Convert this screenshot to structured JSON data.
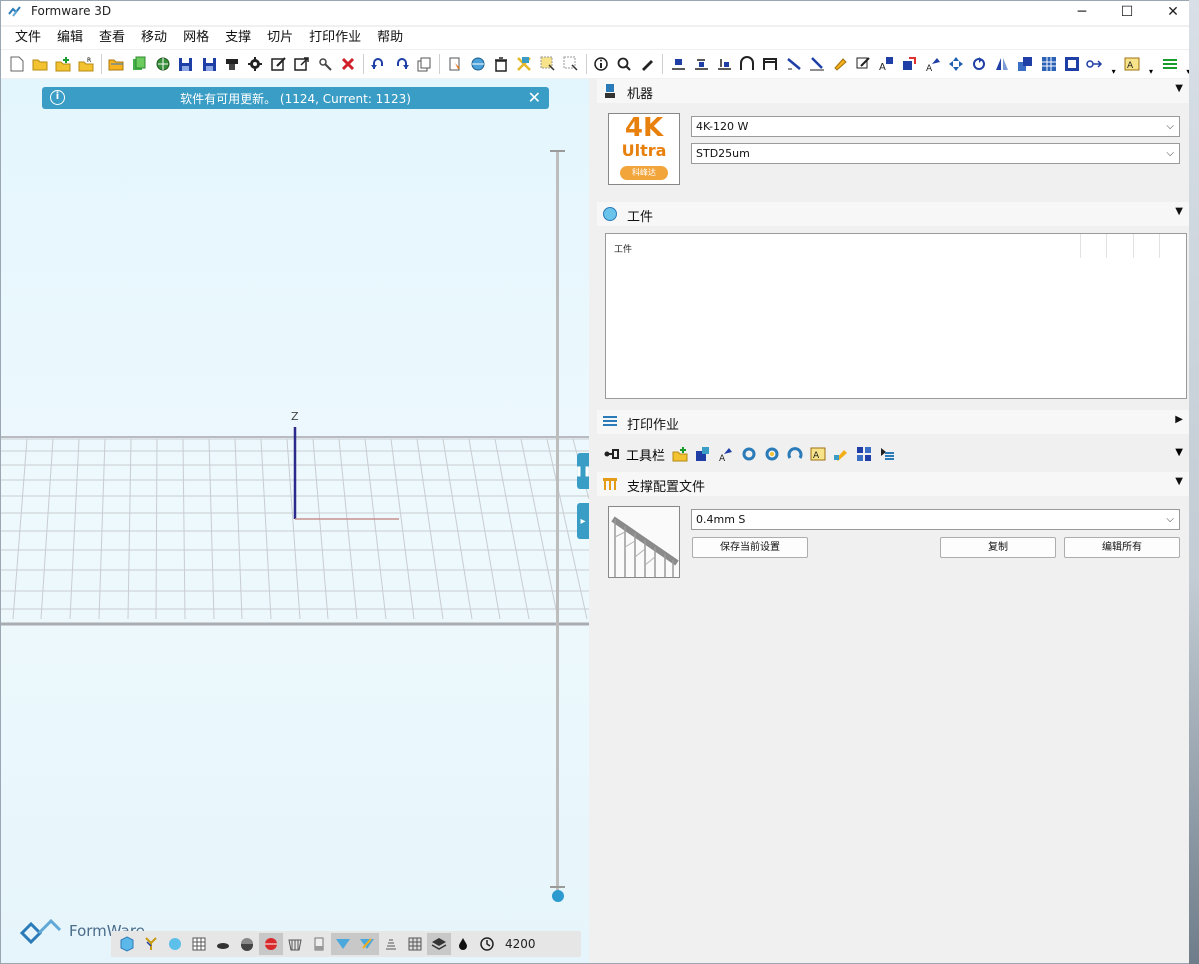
{
  "window": {
    "title": "Formware 3D",
    "controls": {
      "minimize": "─",
      "maximize": "☐",
      "close": "✕"
    }
  },
  "menu": [
    "文件",
    "编辑",
    "查看",
    "移动",
    "网格",
    "支撑",
    "切片",
    "打印作业",
    "帮助"
  ],
  "toolbar_icons": [
    "new-file-icon",
    "open-folder-icon",
    "add-part-icon",
    "add-recent-icon",
    "open-project-icon",
    "copy-green-icon",
    "import-globe-icon",
    "save-icon",
    "save-as-icon",
    "print-icon",
    "settings-gear-icon",
    "edit-icon",
    "export-icon",
    "repair-icon",
    "delete-icon",
    "undo-icon",
    "redo-icon",
    "duplicate-icon",
    "select-icon",
    "view-globe-icon",
    "trash-icon",
    "scale-icon",
    "select-region-icon",
    "deselect-icon",
    "info-icon",
    "search-icon",
    "paint-icon",
    "align-bottom-icon",
    "align-h-icon",
    "align-down-icon",
    "support-arch-icon",
    "support-frame-icon",
    "measure-icon",
    "measure-angle-icon",
    "highlight-icon",
    "pencil-icon",
    "text-icon",
    "orient-icon",
    "label-icon",
    "arrange-icon",
    "rotate-icon",
    "mirror-icon",
    "layout-icon",
    "grid-icon",
    "hollow-icon",
    "link-icon",
    "text-tag-icon",
    "layers-icon"
  ],
  "viewport": {
    "notice": "软件有可用更新。  (1124, Current: 1123)",
    "axis_z": "Z",
    "brand": "FormWare",
    "layer_value": "4200"
  },
  "bottom_icons": [
    "cube-icon",
    "support-tree-icon",
    "sphere-icon",
    "grid-pattern-icon",
    "disc-icon",
    "half-sphere-icon",
    "red-sphere-icon",
    "basket-icon",
    "profile-icon",
    "view-flag-icon",
    "view-flag-highlight-icon",
    "slices-icon",
    "grid-table-icon",
    "layers-stack-icon",
    "drop-icon",
    "clock-icon"
  ],
  "panel": {
    "machine": {
      "title": "机器",
      "printer": "4K-120 W",
      "resin": "STD25um",
      "logo": {
        "line1": "4K",
        "line2": "Ultra",
        "badge": "科峰达"
      }
    },
    "work": {
      "title": "工件",
      "header": "工件"
    },
    "jobs": {
      "title": "打印作业"
    },
    "tools": {
      "title": "工具栏",
      "icons": [
        "add-icon",
        "square-blue-icon",
        "orient-part-icon",
        "ring-icon",
        "ring-yellow-icon",
        "ring-arc-icon",
        "text-frame-icon",
        "pencil-tool-icon",
        "arrange-grid-icon",
        "layers-list-icon"
      ]
    },
    "support": {
      "title": "支撑配置文件",
      "profile": "0.4mm S",
      "save_label": "保存当前设置",
      "copy_label": "复制",
      "edit_label": "编辑所有"
    }
  }
}
